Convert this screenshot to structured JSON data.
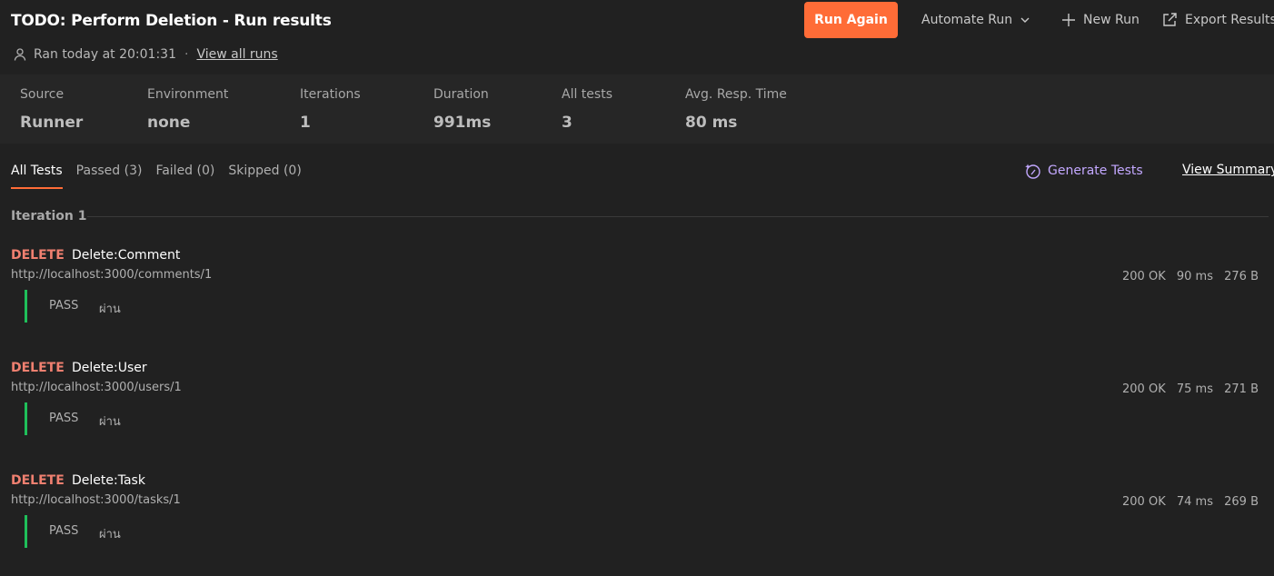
{
  "header": {
    "title": "TODO: Perform Deletion - Run results",
    "ran_at": "Ran today at 20:01:31",
    "separator": "·",
    "view_all_runs": "View all runs",
    "run_again": "Run Again",
    "automate_run": "Automate Run",
    "new_run": "New Run",
    "export_results": "Export Results"
  },
  "stats": [
    {
      "label": "Source",
      "value": "Runner"
    },
    {
      "label": "Environment",
      "value": "none"
    },
    {
      "label": "Iterations",
      "value": "1"
    },
    {
      "label": "Duration",
      "value": "991ms"
    },
    {
      "label": "All tests",
      "value": "3"
    },
    {
      "label": "Avg. Resp. Time",
      "value": "80 ms"
    }
  ],
  "tabs": [
    {
      "label": "All Tests",
      "active": true
    },
    {
      "label": "Passed (3)",
      "active": false
    },
    {
      "label": "Failed (0)",
      "active": false
    },
    {
      "label": "Skipped (0)",
      "active": false
    }
  ],
  "actions": {
    "generate_tests": "Generate Tests",
    "view_summary": "View Summary"
  },
  "iteration": {
    "label": "Iteration 1"
  },
  "requests": [
    {
      "method": "DELETE",
      "name": "Delete:Comment",
      "url": "http://localhost:3000/comments/1",
      "status": "200 OK",
      "time": "90 ms",
      "size": "276 B",
      "result": "PASS",
      "test_name": "ผ่าน"
    },
    {
      "method": "DELETE",
      "name": "Delete:User",
      "url": "http://localhost:3000/users/1",
      "status": "200 OK",
      "time": "75 ms",
      "size": "271 B",
      "result": "PASS",
      "test_name": "ผ่าน"
    },
    {
      "method": "DELETE",
      "name": "Delete:Task",
      "url": "http://localhost:3000/tasks/1",
      "status": "200 OK",
      "time": "74 ms",
      "size": "269 B",
      "result": "PASS",
      "test_name": "ผ่าน"
    }
  ],
  "colors": {
    "background": "#212121",
    "stats_band": "#262626",
    "accent": "#ff6c37",
    "method_delete": "#f08070",
    "pass_bar": "#1fbf5a",
    "generate_tests": "#c3a8ff"
  },
  "icons": {
    "user": "user-icon",
    "chevron": "chevron-down-icon",
    "plus": "plus-icon",
    "export": "export-icon",
    "sparkle": "sparkle-icon"
  }
}
